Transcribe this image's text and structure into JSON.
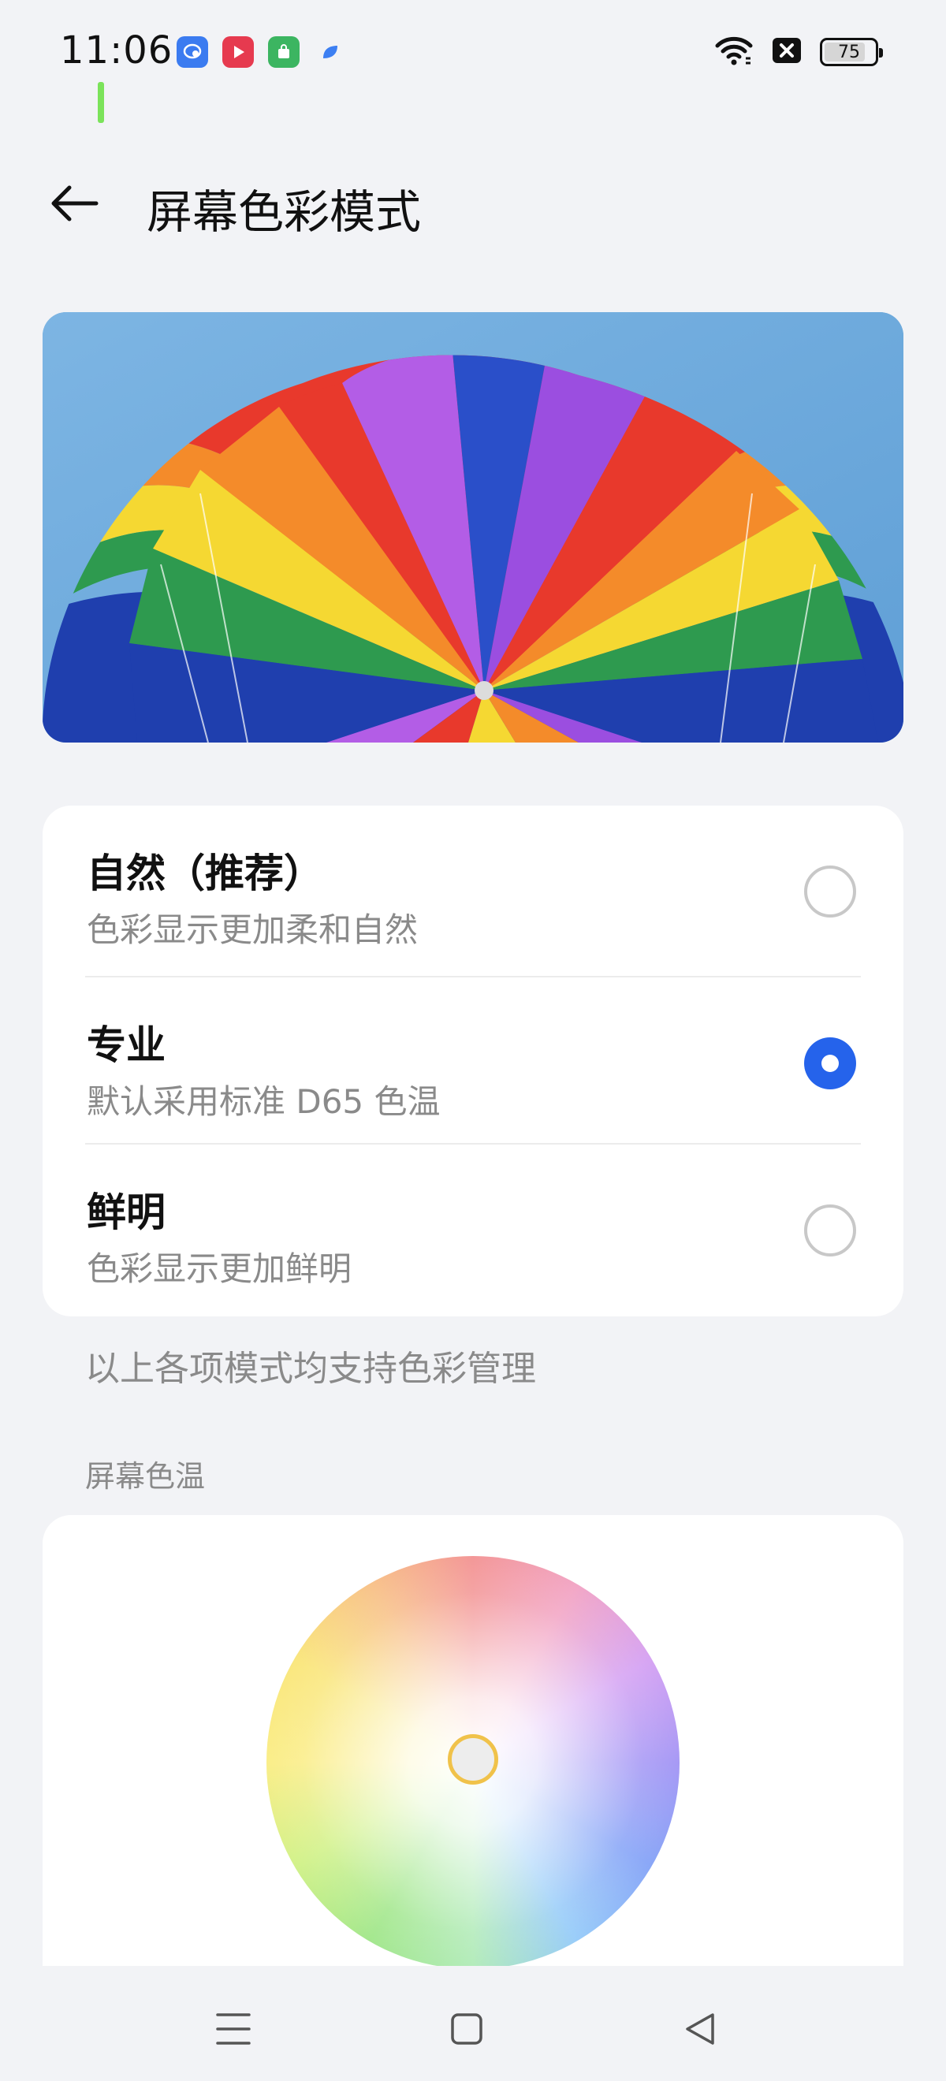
{
  "status_bar": {
    "time": "11:06",
    "battery": "75",
    "apps": [
      "chat-bubble-icon",
      "video-play-icon",
      "shopping-bag-icon",
      "blue-leaf-icon"
    ],
    "icons": [
      "wifi-icon",
      "signal-off-icon",
      "battery-icon"
    ]
  },
  "header": {
    "back_icon": "arrow-left-icon",
    "title": "屏幕色彩模式"
  },
  "hero": {
    "image": "rainbow-parachute-photo"
  },
  "options": [
    {
      "title": "自然（推荐）",
      "desc": "色彩显示更加柔和自然",
      "selected": false
    },
    {
      "title": "专业",
      "desc": "默认采用标准 D65 色温",
      "selected": true
    },
    {
      "title": "鲜明",
      "desc": "色彩显示更加鲜明",
      "selected": false
    }
  ],
  "footnote": "以上各项模式均支持色彩管理",
  "color_temp": {
    "label": "屏幕色温"
  },
  "nav": {
    "items": [
      "menu-icon",
      "home-icon",
      "back-triangle-icon"
    ]
  },
  "colors": {
    "accent": "#2563eb",
    "background": "#f2f3f6",
    "card": "#ffffff",
    "secondary_text": "#8a8a8a"
  }
}
